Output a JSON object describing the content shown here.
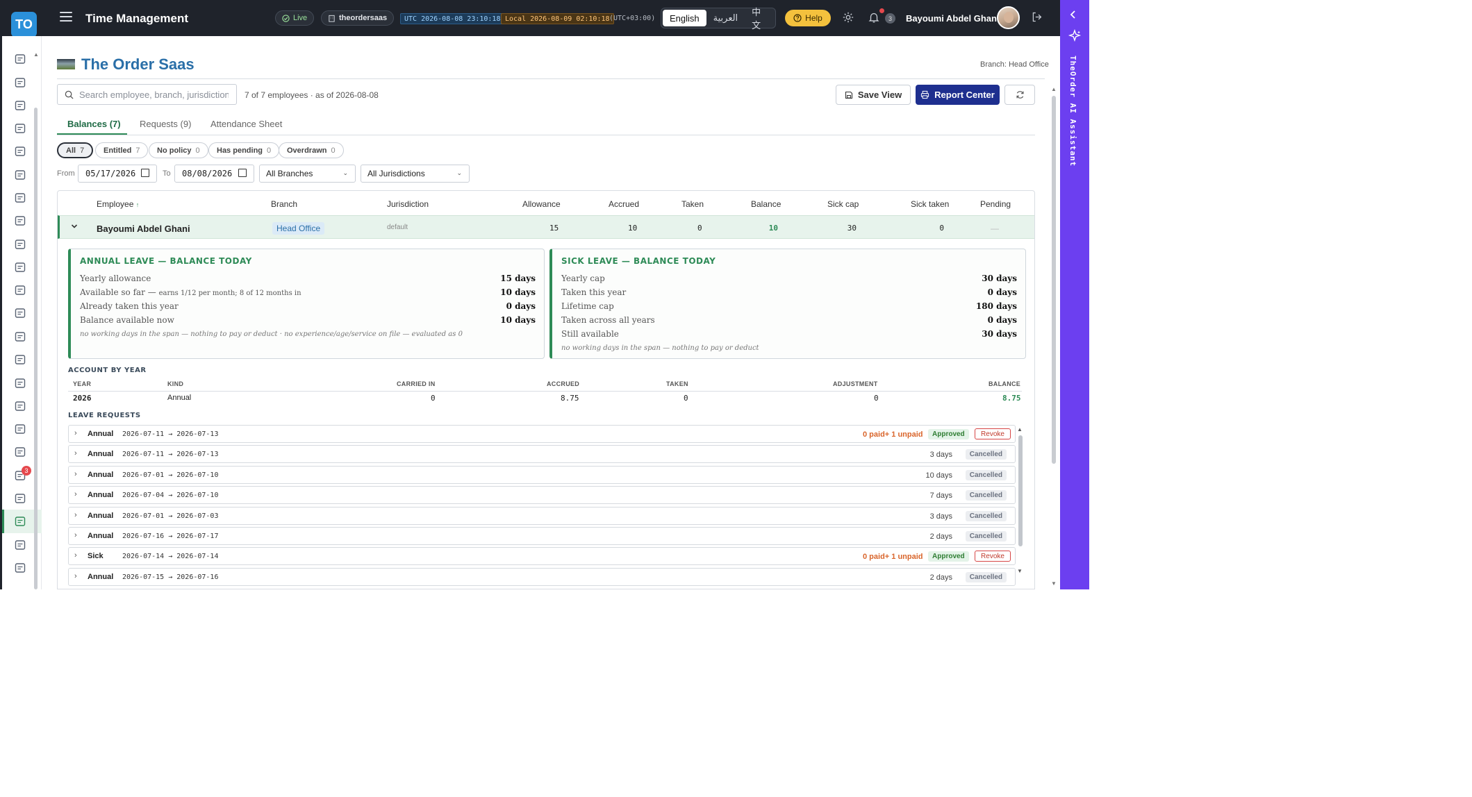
{
  "header": {
    "logo_text": "TO",
    "app_title": "Time Management",
    "live_label": "Live",
    "tenant": "theordersaas",
    "utc_label": "UTC 2026-08-08 23:10:18",
    "local_label": "Local 2026-08-09 02:10:18",
    "tz_offset": "(UTC+03:00)",
    "languages": [
      "English",
      "العربية",
      "中文"
    ],
    "active_language": "English",
    "help_label": "Help",
    "notification_count": "3",
    "user_name": "Bayoumi Abdel Ghani"
  },
  "sidebar": {
    "icons": [
      "cart-icon",
      "clipboard-check-icon",
      "archive-icon",
      "box-icon",
      "layers-icon",
      "users-icon",
      "badge-icon",
      "accessibility-icon",
      "briefcase-icon",
      "invoice-icon",
      "wallet-icon",
      "bank-icon",
      "document-icon",
      "book-icon",
      "dollar-icon",
      "bar-chart-icon",
      "percent-icon",
      "inbox-icon",
      "megaphone-icon",
      "team-icon",
      "time-calendar-icon",
      "card-icon",
      "activity-icon"
    ],
    "active_item": "time-calendar-icon",
    "megaphone_badge": "3"
  },
  "assistant": {
    "label": "TheOrder AI Assistant"
  },
  "page": {
    "company_name": "The Order Saas",
    "branch_label": "Branch: Head Office",
    "search_placeholder": "Search employee, branch, jurisdiction...",
    "employee_count": "7 of 7 employees · as of 2026-08-08",
    "save_view": "Save View",
    "report_center": "Report Center"
  },
  "tabs": [
    {
      "label": "Balances (7)",
      "active": true
    },
    {
      "label": "Requests (9)",
      "active": false
    },
    {
      "label": "Attendance Sheet",
      "active": false
    }
  ],
  "chips": [
    {
      "label": "All",
      "count": "7",
      "active": true
    },
    {
      "label": "Entitled",
      "count": "7",
      "active": false
    },
    {
      "label": "No policy",
      "count": "0",
      "active": false
    },
    {
      "label": "Has pending",
      "count": "0",
      "active": false
    },
    {
      "label": "Overdrawn",
      "count": "0",
      "active": false
    }
  ],
  "filters": {
    "from_label": "From",
    "from_value": "05/17/2026",
    "to_label": "To",
    "to_value": "08/08/2026",
    "branch": "All Branches",
    "jurisdiction": "All Jurisdictions"
  },
  "table": {
    "columns": [
      "Employee",
      "Branch",
      "Jurisdiction",
      "Allowance",
      "Accrued",
      "Taken",
      "Balance",
      "Sick cap",
      "Sick taken",
      "Pending"
    ],
    "row": {
      "employee": "Bayoumi Abdel Ghani",
      "branch": "Head Office",
      "jurisdiction": "default",
      "allowance": "15",
      "accrued": "10",
      "taken": "0",
      "balance": "10",
      "sick_cap": "30",
      "sick_taken": "0",
      "pending": "—"
    }
  },
  "annual": {
    "title": "ANNUAL LEAVE — BALANCE TODAY",
    "rows": [
      {
        "label": "Yearly allowance",
        "note": "",
        "value": "15 days"
      },
      {
        "label": "Available so far —",
        "note": "earns 1/12 per month; 8 of 12 months in",
        "value": "10 days"
      },
      {
        "label": "Already taken this year",
        "note": "",
        "value": "0 days"
      },
      {
        "label": "Balance available now",
        "note": "",
        "value": "10 days"
      }
    ],
    "footnote": "no working days in the span — nothing to pay or deduct · no experience/age/service on file — evaluated as 0"
  },
  "sick": {
    "title": "SICK LEAVE — BALANCE TODAY",
    "rows": [
      {
        "label": "Yearly cap",
        "value": "30 days"
      },
      {
        "label": "Taken this year",
        "value": "0 days"
      },
      {
        "label": "Lifetime cap",
        "value": "180 days"
      },
      {
        "label": "Taken across all years",
        "value": "0 days"
      },
      {
        "label": "Still available",
        "value": "30 days"
      }
    ],
    "footnote": "no working days in the span — nothing to pay or deduct"
  },
  "account": {
    "title": "ACCOUNT BY YEAR",
    "columns": [
      "YEAR",
      "KIND",
      "CARRIED IN",
      "ACCRUED",
      "TAKEN",
      "ADJUSTMENT",
      "BALANCE"
    ],
    "row": {
      "year": "2026",
      "kind": "Annual",
      "carried_in": "0",
      "accrued": "8.75",
      "taken": "0",
      "adjustment": "0",
      "balance": "8.75"
    }
  },
  "leave_requests": {
    "title": "LEAVE REQUESTS",
    "revoke_label": "Revoke",
    "items": [
      {
        "type": "Annual",
        "range": "2026-07-11 → 2026-07-13",
        "days": "0 paid+ 1 unpaid",
        "status": "Approved"
      },
      {
        "type": "Annual",
        "range": "2026-07-11 → 2026-07-13",
        "days": "3 days",
        "status": "Cancelled"
      },
      {
        "type": "Annual",
        "range": "2026-07-01 → 2026-07-10",
        "days": "10 days",
        "status": "Cancelled"
      },
      {
        "type": "Annual",
        "range": "2026-07-04 → 2026-07-10",
        "days": "7 days",
        "status": "Cancelled"
      },
      {
        "type": "Annual",
        "range": "2026-07-01 → 2026-07-03",
        "days": "3 days",
        "status": "Cancelled"
      },
      {
        "type": "Annual",
        "range": "2026-07-16 → 2026-07-17",
        "days": "2 days",
        "status": "Cancelled"
      },
      {
        "type": "Sick",
        "range": "2026-07-14 → 2026-07-14",
        "days": "0 paid+ 1 unpaid",
        "status": "Approved"
      },
      {
        "type": "Annual",
        "range": "2026-07-15 → 2026-07-16",
        "days": "2 days",
        "status": "Cancelled"
      }
    ]
  },
  "colors": {
    "brand_green": "#2e8b57",
    "company_blue": "#2a6fa8",
    "report_button": "#1e2f8f",
    "assistant_rail": "#6c3ff0",
    "topbar": "#1f232b"
  }
}
